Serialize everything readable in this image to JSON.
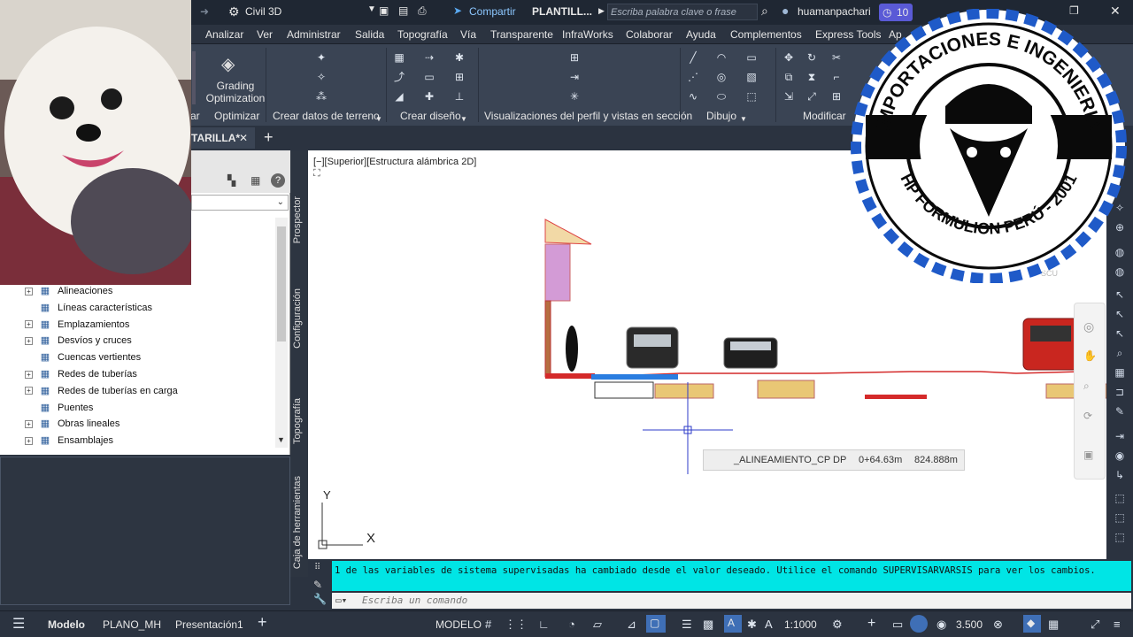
{
  "title_bar": {
    "product": "Civil 3D",
    "share_label": "Compartir",
    "file_name": "PLANTILL...",
    "search_placeholder": "Escriba palabra clave o frase",
    "user": "huamanpachari",
    "notification_count": "10"
  },
  "menu": [
    "Analizar",
    "Ver",
    "Administrar",
    "Salida",
    "Topografía",
    "Vía",
    "Transparente",
    "InfraWorks",
    "Colaborar",
    "Ayuda",
    "Complementos",
    "Express Tools",
    "Ap"
  ],
  "ribbon": {
    "grading_button": "Grading\nOptimization",
    "panels": {
      "optimizar": "Optimizar",
      "crear_datos": "Crear datos de terreno",
      "crear_diseno": "Crear diseño",
      "visualizaciones": "Visualizaciones del perfil y vistas en sección",
      "dibujo": "Dibujo",
      "modificar": "Modificar"
    }
  },
  "doc_tab": "TARILLA*",
  "viewport_label": "[−][Superior][Estructura alámbrica 2D]",
  "toolspace": {
    "tree": [
      {
        "label": "Alineaciones",
        "expand": "+"
      },
      {
        "label": "Líneas características",
        "expand": ""
      },
      {
        "label": "Emplazamientos",
        "expand": "+"
      },
      {
        "label": "Desvíos y cruces",
        "expand": "+"
      },
      {
        "label": "Cuencas vertientes",
        "expand": ""
      },
      {
        "label": "Redes de tuberías",
        "expand": "+"
      },
      {
        "label": "Redes de tuberías en carga",
        "expand": "+"
      },
      {
        "label": "Puentes",
        "expand": ""
      },
      {
        "label": "Obras lineales",
        "expand": "+"
      },
      {
        "label": "Ensamblajes",
        "expand": "+"
      }
    ],
    "vertical_tabs": [
      "Prospector",
      "Configuración",
      "Topografía",
      "Caja de herramientas"
    ]
  },
  "tooltip": {
    "alignment": "_ALINEAMIENTO_CP",
    "dp": "DP",
    "station": "0+64.63m",
    "elevation": "824.888m"
  },
  "ucs": {
    "y": "Y",
    "x": "X"
  },
  "command_line": {
    "message": "1 de las variables de sistema supervisadas ha cambiado desde el valor deseado. Utilice el comando SUPERVISARVARSIS para ver los cambios.",
    "placeholder": "Escriba un comando"
  },
  "status_bar": {
    "tabs": [
      "Modelo",
      "PLANO_MH",
      "Presentación1"
    ],
    "mode": "MODELO",
    "scale": "1:1000",
    "value": "3.500"
  },
  "logo": {
    "top_text": "IMPORTACIONES E INGENIERIA",
    "bottom_text": "HP FORMULION PERÚ - 2001",
    "circle_text": "SCU"
  },
  "colors": {
    "accent": "#00e5e5",
    "ribbon": "#3a4454",
    "title": "#1f2733",
    "road": "#d42a2a"
  }
}
